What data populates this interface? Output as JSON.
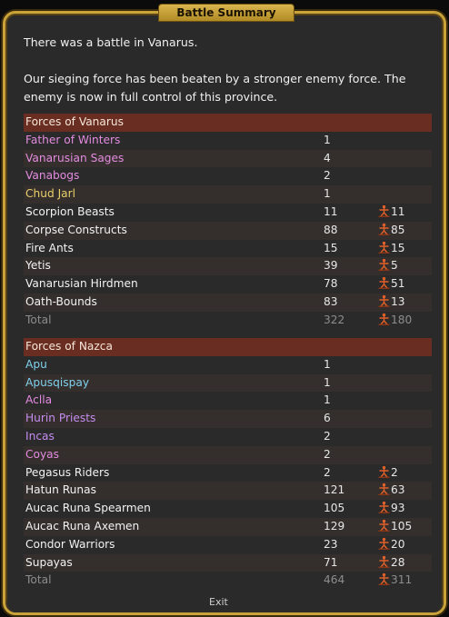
{
  "dialog": {
    "title": "Battle Summary",
    "message_line1": "There was a battle in Vanarus.",
    "message_line2": "Our sieging force has been beaten by a stronger enemy force. The enemy is now in full control of this province.",
    "exit_label": "Exit"
  },
  "forces": [
    {
      "header": "Forces of Vanarus",
      "units": [
        {
          "name": "Father of Winters",
          "count": "1",
          "lost": "",
          "color": "pink"
        },
        {
          "name": "Vanarusian Sages",
          "count": "4",
          "lost": "",
          "color": "pink"
        },
        {
          "name": "Vanabogs",
          "count": "2",
          "lost": "",
          "color": "pink"
        },
        {
          "name": "Chud Jarl",
          "count": "1",
          "lost": "",
          "color": "yellow"
        },
        {
          "name": "Scorpion Beasts",
          "count": "11",
          "lost": "11",
          "color": "unit"
        },
        {
          "name": "Corpse Constructs",
          "count": "88",
          "lost": "85",
          "color": "unit"
        },
        {
          "name": "Fire Ants",
          "count": "15",
          "lost": "15",
          "color": "unit"
        },
        {
          "name": "Yetis",
          "count": "39",
          "lost": "5",
          "color": "unit"
        },
        {
          "name": "Vanarusian Hirdmen",
          "count": "78",
          "lost": "51",
          "color": "unit"
        },
        {
          "name": "Oath-Bounds",
          "count": "83",
          "lost": "13",
          "color": "unit"
        }
      ],
      "total_label": "Total",
      "total_count": "322",
      "total_lost": "180"
    },
    {
      "header": "Forces of Nazca",
      "units": [
        {
          "name": "Apu",
          "count": "1",
          "lost": "",
          "color": "blue"
        },
        {
          "name": "Apusqispay",
          "count": "1",
          "lost": "",
          "color": "blue"
        },
        {
          "name": "Aclla",
          "count": "1",
          "lost": "",
          "color": "pink"
        },
        {
          "name": "Hurin Priests",
          "count": "6",
          "lost": "",
          "color": "purple"
        },
        {
          "name": "Incas",
          "count": "2",
          "lost": "",
          "color": "purple"
        },
        {
          "name": "Coyas",
          "count": "2",
          "lost": "",
          "color": "pink"
        },
        {
          "name": "Pegasus Riders",
          "count": "2",
          "lost": "2",
          "color": "unit"
        },
        {
          "name": "Hatun Runas",
          "count": "121",
          "lost": "63",
          "color": "unit"
        },
        {
          "name": "Aucac Runa Spearmen",
          "count": "105",
          "lost": "93",
          "color": "unit"
        },
        {
          "name": "Aucac Runa Axemen",
          "count": "129",
          "lost": "105",
          "color": "unit"
        },
        {
          "name": "Condor Warriors",
          "count": "23",
          "lost": "20",
          "color": "unit"
        },
        {
          "name": "Supayas",
          "count": "71",
          "lost": "28",
          "color": "unit"
        }
      ],
      "total_label": "Total",
      "total_count": "464",
      "total_lost": "311"
    }
  ],
  "icons": {
    "casualty": "fallen-soldier-icon"
  },
  "colors": {
    "frame_gold": "#c9a23a",
    "header_red": "#6a2d22",
    "panel_bg": "#2a2a2a",
    "commander_pink": "#e48be0",
    "commander_blue": "#7fd0ec",
    "commander_purple": "#c58cf0",
    "commander_yellow": "#e9cf6a",
    "casualty_icon": "#e0612a"
  }
}
